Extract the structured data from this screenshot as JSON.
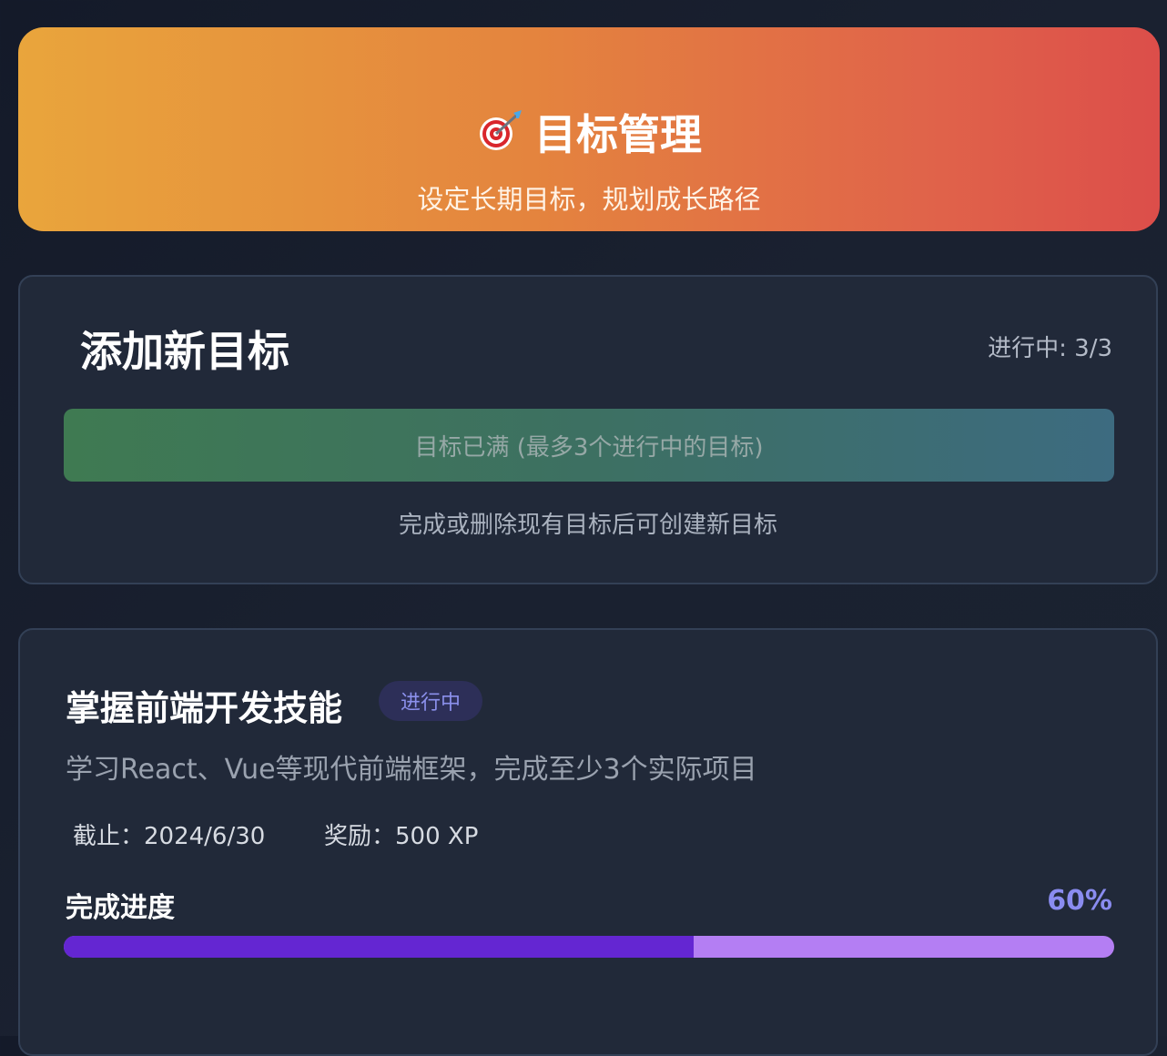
{
  "header": {
    "icon": "target-dart-icon",
    "title": "目标管理",
    "subtitle": "设定长期目标，规划成长路径"
  },
  "add_goal": {
    "title": "添加新目标",
    "active_count": "进行中: 3/3",
    "full_button_label": "目标已满 (最多3个进行中的目标)",
    "hint": "完成或删除现有目标后可创建新目标"
  },
  "goals": [
    {
      "title": "掌握前端开发技能",
      "status": "进行中",
      "description": "学习React、Vue等现代前端框架，完成至少3个实际项目",
      "deadline": "截止：2024/6/30",
      "reward": "奖励：500 XP",
      "progress_label": "完成进度",
      "progress_text": "60%",
      "progress_fraction": 0.6
    }
  ],
  "colors": {
    "header_gradient_start": "#e9a53c",
    "header_gradient_end": "#dc4e4a",
    "progress_fill": "#6426d2",
    "progress_track": "#b47ef3",
    "badge_text": "#8b90ec"
  }
}
